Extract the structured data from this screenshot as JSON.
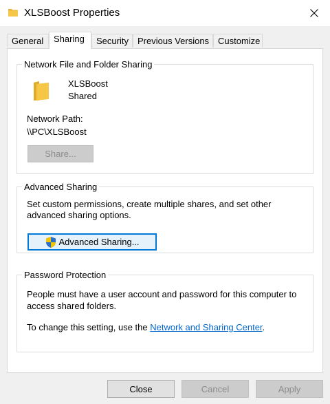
{
  "window": {
    "title": "XLSBoost Properties",
    "close_glyph": "✕"
  },
  "tabs": [
    {
      "label": "General"
    },
    {
      "label": "Sharing",
      "active": true
    },
    {
      "label": "Security"
    },
    {
      "label": "Previous Versions"
    },
    {
      "label": "Customize"
    }
  ],
  "network_sharing": {
    "legend": "Network File and Folder Sharing",
    "item_name": "XLSBoost",
    "item_status": "Shared",
    "path_label": "Network Path:",
    "path_value": "\\\\PC\\XLSBoost",
    "share_button": "Share..."
  },
  "advanced_sharing": {
    "legend": "Advanced Sharing",
    "description": "Set custom permissions, create multiple shares, and set other advanced sharing options.",
    "button": "Advanced Sharing..."
  },
  "password_protection": {
    "legend": "Password Protection",
    "description": "People must have a user account and password for this computer to access shared folders.",
    "change_prefix": "To change this setting, use the ",
    "link": "Network and Sharing Center",
    "change_suffix": "."
  },
  "footer": {
    "close": "Close",
    "cancel": "Cancel",
    "apply": "Apply"
  },
  "colors": {
    "accent": "#0078d7",
    "folder": "#f6c746",
    "link": "#0066cc"
  },
  "icons": {
    "title": "folder-icon",
    "share_folder": "folder-icon",
    "advanced_button": "uac-shield-icon",
    "close": "close-icon"
  }
}
